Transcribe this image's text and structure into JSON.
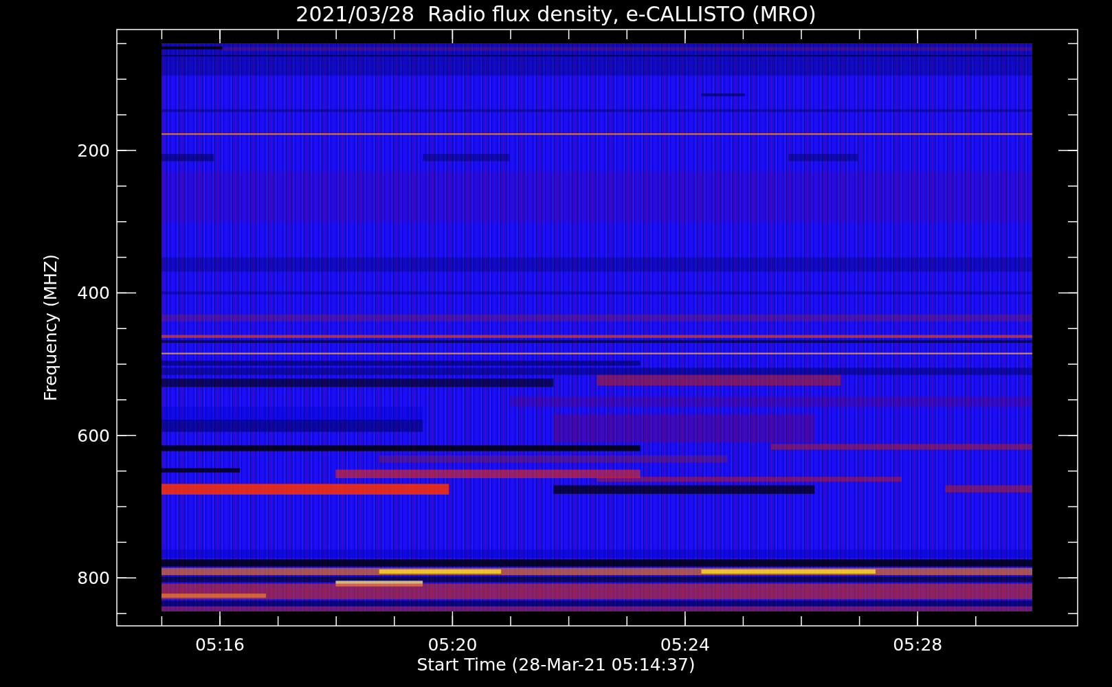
{
  "title": "2021/03/28  Radio flux density, e-CALLISTO (MRO)",
  "ylabel": "Frequency (MHZ)",
  "xlabel": "Start Time (28-Mar-21 05:14:37)",
  "yticks": [
    "200",
    "400",
    "600",
    "800"
  ],
  "xticks": [
    "05:16",
    "05:20",
    "05:24",
    "05:28"
  ]
}
